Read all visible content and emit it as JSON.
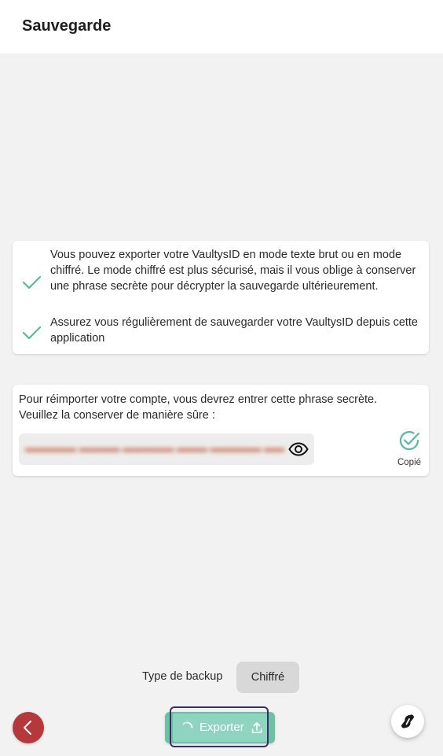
{
  "header": {
    "title": "Sauvegarde"
  },
  "info": {
    "items": [
      {
        "text": "Vous pouvez exporter votre VaultysID en mode texte brut ou en mode chiffré. Le mode chiffré est plus sécurisé, mais il vous oblige à conserver une phrase secrète pour décrypter la sauvegarde ultérieurement.",
        "icon": "check-icon"
      },
      {
        "text": "Assurez vous régulièrement de sauvegarder votre VaultysID depuis cette application",
        "icon": "check-icon"
      }
    ]
  },
  "passphrase": {
    "description": "Pour réimporter votre compte, vous devrez entrer cette phrase secrète. Veuillez la conserver de manière sûre :",
    "reveal_icon": "eye-icon",
    "copied_label": "Copié",
    "copied_icon": "check-circle-icon"
  },
  "backup": {
    "type_label": "Type de backup",
    "type_value": "Chiffré"
  },
  "actions": {
    "back_icon": "chevron-left-icon",
    "export_label": "Exporter",
    "export_icon": "upload-icon",
    "spinner_icon": "spinner-icon",
    "fab_icon": "vaultys-logo-icon"
  },
  "colors": {
    "accent": "#5cb89a",
    "danger": "#b5393c",
    "focus": "#3a2f63"
  }
}
